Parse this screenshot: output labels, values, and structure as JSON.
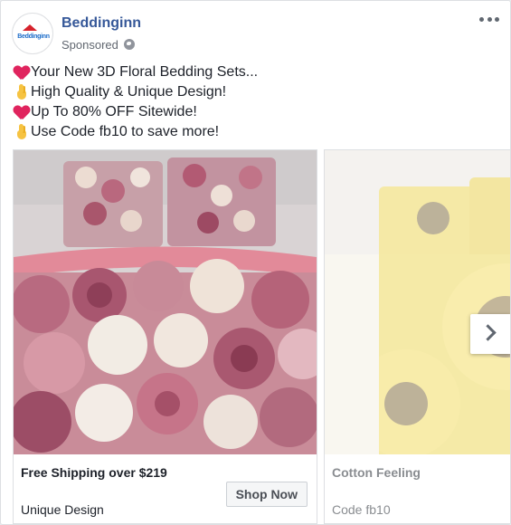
{
  "post": {
    "page_name": "Beddinginn",
    "sponsored_label": "Sponsored",
    "avatar_logo_text": "Beddinginn",
    "privacy_icon": "globe-icon",
    "menu_icon": "more-options-icon"
  },
  "body": {
    "lines": [
      {
        "icon": "heart-icon",
        "text": "Your New 3D Floral Bedding Sets..."
      },
      {
        "icon": "hand-icon",
        "text": "High Quality & Unique Design!"
      },
      {
        "icon": "heart-icon",
        "text": "Up To 80% OFF Sitewide!"
      },
      {
        "icon": "hand-icon",
        "text": "Use Code fb10 to save more!"
      }
    ]
  },
  "carousel": {
    "cards": [
      {
        "image": "pink-rose-floral-bedding-photo",
        "title": "Free Shipping over $219",
        "description": "Unique Design",
        "cta_label": "Shop Now"
      },
      {
        "image": "yellow-sunflower-bedding-photo",
        "title": "Cotton Feeling",
        "description": "Code fb10"
      }
    ],
    "next_icon": "chevron-right-icon"
  },
  "colors": {
    "link_blue": "#365899",
    "heart_red": "#e0245e",
    "border": "#dddfe2"
  }
}
